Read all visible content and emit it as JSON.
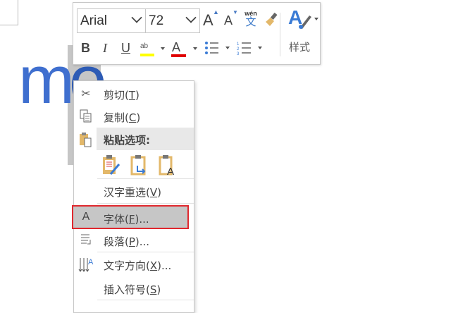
{
  "document": {
    "text_visible": "m",
    "selected_char": "o"
  },
  "toolbar": {
    "font_name": "Arial",
    "font_size": "72",
    "grow_font": "A",
    "shrink_font": "A",
    "phonetic_top": "wén",
    "phonetic_char": "文",
    "bold": "B",
    "italic": "I",
    "underline": "U",
    "highlight_color": "#ffff00",
    "font_color": "#e00000",
    "styles_label": "样式"
  },
  "menu": {
    "cut": {
      "label": "剪切(",
      "key": "T",
      "end": ")"
    },
    "copy": {
      "label": "复制(",
      "key": "C",
      "end": ")"
    },
    "paste_header": "粘贴选项:",
    "reconvert": {
      "label": "汉字重选(",
      "key": "V",
      "end": ")"
    },
    "font": {
      "label": "字体(",
      "key": "F",
      "end": ")..."
    },
    "paragraph": {
      "label": "段落(",
      "key": "P",
      "end": ")..."
    },
    "text_direction": {
      "label": "文字方向(",
      "key": "X",
      "end": ")..."
    },
    "insert_symbol": {
      "label": "插入符号(",
      "key": "S",
      "end": ")"
    }
  },
  "highlight_border": "#e0282e"
}
